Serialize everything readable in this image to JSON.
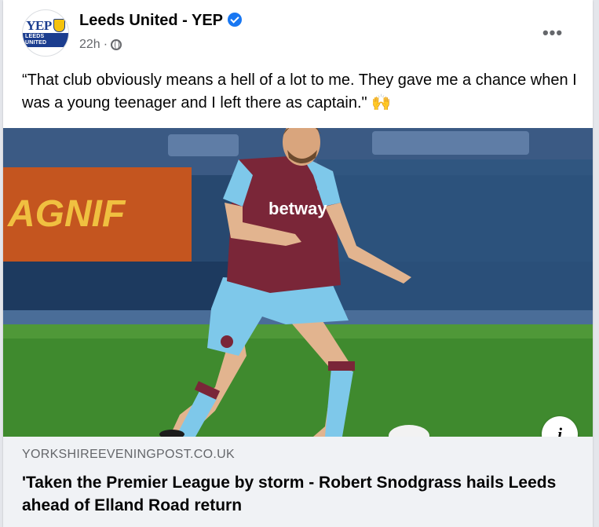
{
  "post": {
    "page_name": "Leeds United - YEP",
    "avatar": {
      "logo_text": "YEP",
      "logo_subtext": "LEEDS UNITED"
    },
    "timestamp": "22h",
    "separator": "·",
    "audience_icon": "globe-icon",
    "more_icon": "more-horizontal-icon",
    "more_label": "•••",
    "caption": "“That club obviously means a hell of a lot to me. They gave me a chance when I was a young teenager and I left there as captain.\"",
    "caption_emoji": "🙌"
  },
  "image": {
    "sponsor_text": "betway",
    "info_icon": "info-icon",
    "info_label": "i"
  },
  "link_preview": {
    "domain": "YORKSHIREEVENINGPOST.CO.UK",
    "title": "'Taken the Premier League by storm - Robert Snodgrass hails Leeds ahead of Elland Road return"
  },
  "colors": {
    "verified_blue": "#1877f2",
    "secondary_text": "#65676b",
    "link_bg": "#f0f2f5",
    "shirt_claret": "#7a2638",
    "shirt_blue": "#7ec8ea",
    "pitch_green": "#3f8a2e"
  }
}
